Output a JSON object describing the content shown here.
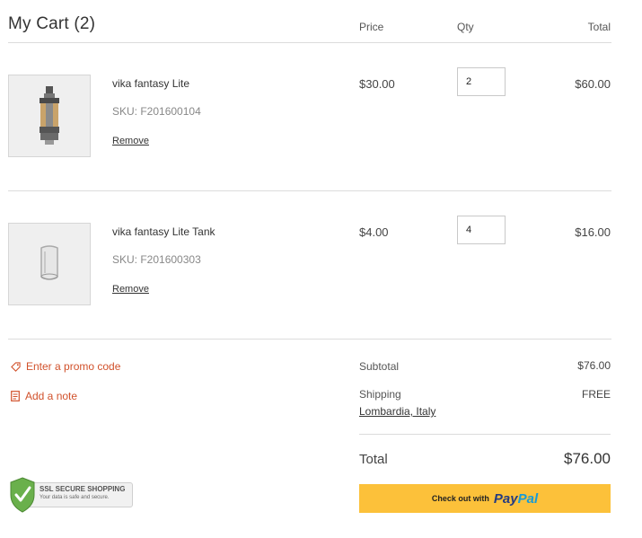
{
  "cart": {
    "title": "My Cart (2)",
    "columns": {
      "price": "Price",
      "qty": "Qty",
      "total": "Total"
    },
    "items": [
      {
        "name": "vika fantasy Lite",
        "sku": "SKU: F201600104",
        "remove_label": "Remove",
        "price": "$30.00",
        "qty": "2",
        "total": "$60.00"
      },
      {
        "name": "vika fantasy Lite Tank",
        "sku": "SKU: F201600303",
        "remove_label": "Remove",
        "price": "$4.00",
        "qty": "4",
        "total": "$16.00"
      }
    ]
  },
  "actions": {
    "promo_label": "Enter a promo code",
    "note_label": "Add a note"
  },
  "summary": {
    "subtotal_label": "Subtotal",
    "subtotal_value": "$76.00",
    "shipping_label": "Shipping",
    "shipping_value": "FREE",
    "shipping_location": "Lombardia, Italy",
    "total_label": "Total",
    "total_value": "$76.00"
  },
  "checkout": {
    "prefix": "Check out with",
    "brand_part1": "Pay",
    "brand_part2": "Pal"
  },
  "badge": {
    "title": "SSL SECURE SHOPPING",
    "subtitle": "Your data is safe and secure."
  },
  "colors": {
    "accent": "#d1512b",
    "checkout_bg": "#fcc13a",
    "paypal_dark": "#253b80",
    "paypal_light": "#179bd7",
    "badge_green": "#6ab04c"
  }
}
